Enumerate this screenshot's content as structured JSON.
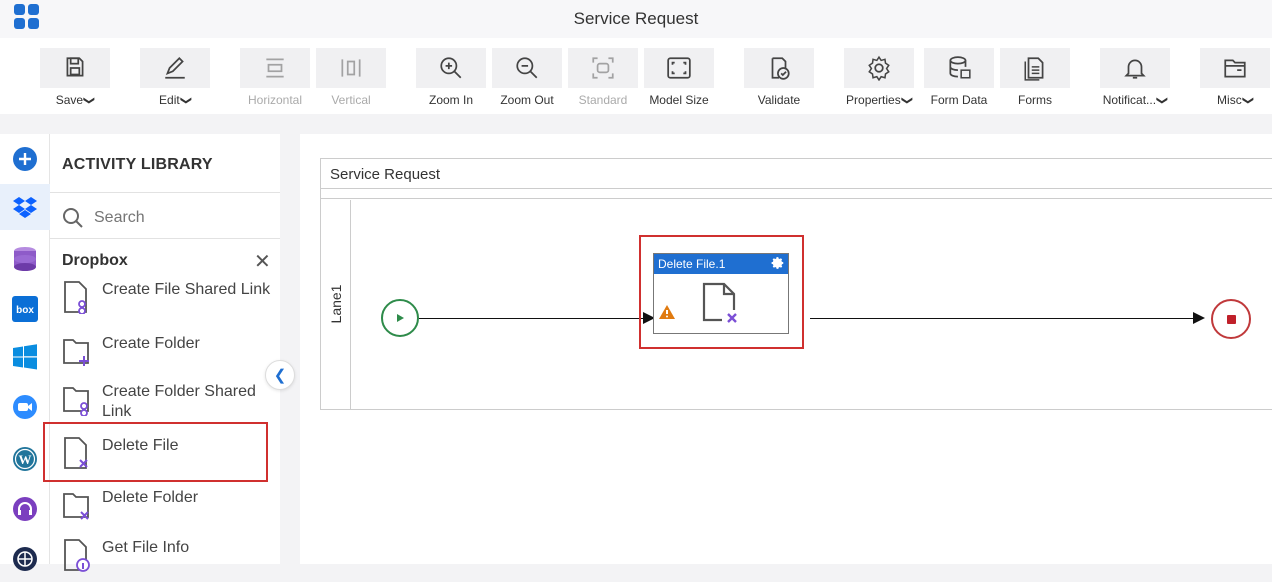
{
  "app": {
    "title": "Service Request"
  },
  "toolbar": {
    "buttons": [
      {
        "id": "save",
        "label": "Save",
        "icon": "save-icon",
        "dropdown": true,
        "disabled": false
      },
      {
        "id": "edit",
        "label": "Edit",
        "icon": "edit-icon",
        "dropdown": true,
        "disabled": false
      },
      {
        "id": "horizontal",
        "label": "Horizontal",
        "icon": "horizontal-layout-icon",
        "dropdown": false,
        "disabled": true
      },
      {
        "id": "vertical",
        "label": "Vertical",
        "icon": "vertical-layout-icon",
        "dropdown": false,
        "disabled": true
      },
      {
        "id": "zoom-in",
        "label": "Zoom In",
        "icon": "zoom-in-icon",
        "dropdown": false,
        "disabled": false
      },
      {
        "id": "zoom-out",
        "label": "Zoom Out",
        "icon": "zoom-out-icon",
        "dropdown": false,
        "disabled": false
      },
      {
        "id": "standard",
        "label": "Standard",
        "icon": "standard-size-icon",
        "dropdown": false,
        "disabled": true
      },
      {
        "id": "model-size",
        "label": "Model Size",
        "icon": "model-size-icon",
        "dropdown": false,
        "disabled": false
      },
      {
        "id": "validate",
        "label": "Validate",
        "icon": "validate-icon",
        "dropdown": false,
        "disabled": false
      },
      {
        "id": "properties",
        "label": "Properties",
        "icon": "gear-icon",
        "dropdown": true,
        "disabled": false
      },
      {
        "id": "form-data",
        "label": "Form Data",
        "icon": "database-icon",
        "dropdown": false,
        "disabled": false
      },
      {
        "id": "forms",
        "label": "Forms",
        "icon": "forms-icon",
        "dropdown": false,
        "disabled": false
      },
      {
        "id": "notifications",
        "label": "Notificat...",
        "icon": "bell-icon",
        "dropdown": true,
        "disabled": false
      },
      {
        "id": "misc",
        "label": "Misc",
        "icon": "folder-icon",
        "dropdown": true,
        "disabled": false
      }
    ]
  },
  "leftrail": {
    "items": [
      {
        "name": "add",
        "icon": "add-circle-icon"
      },
      {
        "name": "dropbox",
        "icon": "dropbox-icon",
        "active": true
      },
      {
        "name": "database",
        "icon": "database-stack-icon"
      },
      {
        "name": "box",
        "icon": "box-icon",
        "label": "box"
      },
      {
        "name": "windows",
        "icon": "windows-icon"
      },
      {
        "name": "zoom",
        "icon": "zoom-video-icon"
      },
      {
        "name": "wordpress",
        "icon": "wordpress-icon"
      },
      {
        "name": "support",
        "icon": "headset-icon"
      },
      {
        "name": "more",
        "icon": "globe-icon"
      }
    ]
  },
  "library": {
    "title": "ACTIVITY LIBRARY",
    "search_placeholder": "Search",
    "category": "Dropbox",
    "items": [
      {
        "label": "Create File Shared Link",
        "icon": "file-link-icon"
      },
      {
        "label": "Create Folder",
        "icon": "folder-add-icon"
      },
      {
        "label": "Create Folder Shared Link",
        "icon": "folder-link-icon"
      },
      {
        "label": "Delete File",
        "icon": "file-delete-icon",
        "highlighted": true
      },
      {
        "label": "Delete Folder",
        "icon": "folder-delete-icon"
      },
      {
        "label": "Get File Info",
        "icon": "file-info-icon"
      }
    ]
  },
  "canvas": {
    "pool_title": "Service Request",
    "lane_label": "Lane1",
    "task": {
      "title": "Delete File.1",
      "warning": true,
      "highlighted": true
    }
  },
  "colors": {
    "accent": "#1f6fd1",
    "highlight": "#d0302f",
    "start": "#2e8b4a",
    "end": "#c0393b",
    "icon_purple": "#7b4fd6"
  }
}
